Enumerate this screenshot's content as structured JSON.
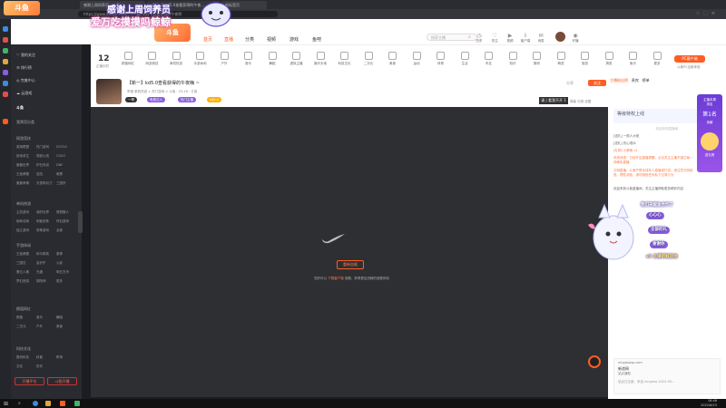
{
  "browser": {
    "tabs": [
      {
        "label": "感谢上周饲养员 - 斗鱼"
      },
      {
        "label": "【新一】kd5.0查看获得的午夜…"
      },
      {
        "label": "新标签页"
      }
    ],
    "url": "https://www.douyu.com/…(一键) kd5.0音看获得的午夜啊",
    "icons": [
      "star-icon",
      "extension-icon",
      "menu-icon"
    ]
  },
  "overlay": {
    "line1": "感谢上周饲养员",
    "line2": "爱万吃摸摸吗鲸鲸",
    "logo": "斗鱼"
  },
  "header": {
    "logo": "斗鱼",
    "nav": [
      "首页",
      "直播",
      "分类",
      "视频",
      "游戏",
      "鱼吧"
    ],
    "search_placeholder": "搜索主播",
    "icons": [
      {
        "name": "history-icon",
        "label": "历史"
      },
      {
        "name": "follow-icon",
        "label": "关注"
      },
      {
        "name": "video-icon",
        "label": "视频"
      },
      {
        "name": "download-icon",
        "label": "客户端"
      },
      {
        "name": "message-icon",
        "label": "消息"
      },
      {
        "name": "live-icon",
        "label": "开播"
      }
    ]
  },
  "categories": {
    "count": "12",
    "count_label": "正播中的",
    "items": [
      "颜值网红",
      "网游竞技",
      "单机热游",
      "手游休闲",
      "户外",
      "音乐",
      "舞蹈",
      "虚拟主播",
      "娱乐天地",
      "科技文化",
      "二次元",
      "美食",
      "运动",
      "体育",
      "生活",
      "车友",
      "知识",
      "数码",
      "萌宠",
      "旅游",
      "搞笑",
      "鱼乐",
      "更多"
    ],
    "pc_button": "PC客户端",
    "pc_sub": "斗鱼PC全新体验"
  },
  "sidebar": {
    "top_items": [
      "我的关注",
      "排行榜",
      "完美中心",
      "云游戏"
    ],
    "brand": "斗鱼",
    "sections": [
      {
        "title": "我常用分类",
        "items": []
      },
      {
        "title": "网游竞技",
        "items": [
          "英雄联盟",
          "热门游戏",
          "DOTA2",
          "绝地求生",
          "穿越火线",
          "CSGO",
          "魔兽世界",
          "炉石传说",
          "DNF",
          "王者荣耀",
          "逆战",
          "暗黑",
          "魔兽争霸",
          "天涯明月刀",
          "三国杀"
        ]
      },
      {
        "title": "单机热游",
        "items": [
          "主机游戏",
          "我的世界",
          "怪物猎人",
          "使命召唤",
          "刺客信条",
          "怀旧游戏",
          "独立游戏",
          "恐怖游戏",
          "全部"
        ]
      },
      {
        "title": "手游休闲",
        "items": [
          "王者荣耀",
          "和平精英",
          "原神",
          "三国志",
          "金铲铲",
          "火影",
          "第五人格",
          "光遇",
          "明日方舟",
          "梦幻西游",
          "阴阳师",
          "更多"
        ]
      },
      {
        "title": "颜值网红",
        "items": [
          "颜值",
          "音乐",
          "舞蹈",
          "二次元",
          "户外",
          "美食"
        ]
      },
      {
        "title": "科技文化",
        "items": [
          "数码科技",
          "科普",
          "职场",
          "文化",
          "历史"
        ]
      }
    ],
    "btn1": "开播平台",
    "btn2": "斗鱼开播"
  },
  "room": {
    "title": "【新一】kd5.0查看获得的午夜嗨 ~",
    "meta": "举报  单机热游 > 热门游戏 > 斗鱼 · 23:16 · 订阅",
    "tags": [
      "一哥",
      "电竞达人",
      "热门主播",
      "国服打野",
      "kd5.0"
    ],
    "follow": "关注",
    "share": "分享",
    "subtitle_btn": "请 | 看我不开 1",
    "small_tags": "弹幕 礼物 设置"
  },
  "player": {
    "button": "重新加载",
    "message_prefix": "您好可以 ",
    "message_highlight": "下载客户端",
    "message_suffix": " 观看，获得更加流畅的观看体验"
  },
  "chat": {
    "tabs": [
      "主播粉丝榜",
      "贵宾",
      "榜单"
    ],
    "notice": "等级特权上线",
    "lines": [
      "- 欢迎来到直播间 -",
      "[送礼] 一般人大佬",
      "[送礼] 热心观众",
      "[礼物] 小鲸鱼 x1",
      "系统消息：已经开启直播提醒，点击关注主播不错过每一场精彩直播",
      "文明直播：斗鱼严禁未成年人直播或打赏，请注意文明用语，理性消费，请勿相信任何私下交易行为",
      "欢迎来到斗鱼直播间，关注主播获取更多精彩内容"
    ],
    "ad_site": "ningduosp.com",
    "ad_title": "新浪网",
    "ad_sub": "站点通知",
    "ad_footer": "站点已注册，来自 ningduo 2022-05…"
  },
  "rank_panel": {
    "lines": [
      "主播本周",
      "排名",
      "第1名",
      "贡献",
      "送礼物"
    ]
  },
  "mascot_bubbles": [
    "我们来鲸鱼合作了",
    "心心心",
    "全部的礼",
    "谢谢你",
    "x9 主播把鲸送给"
  ],
  "taskbar": {
    "time": "16:46",
    "date": "2022/6/23"
  },
  "colors": {
    "accent": "#ff5d23",
    "sidebar": "#2a2b30",
    "player": "#2e2f33",
    "rank": "#7a44de"
  }
}
